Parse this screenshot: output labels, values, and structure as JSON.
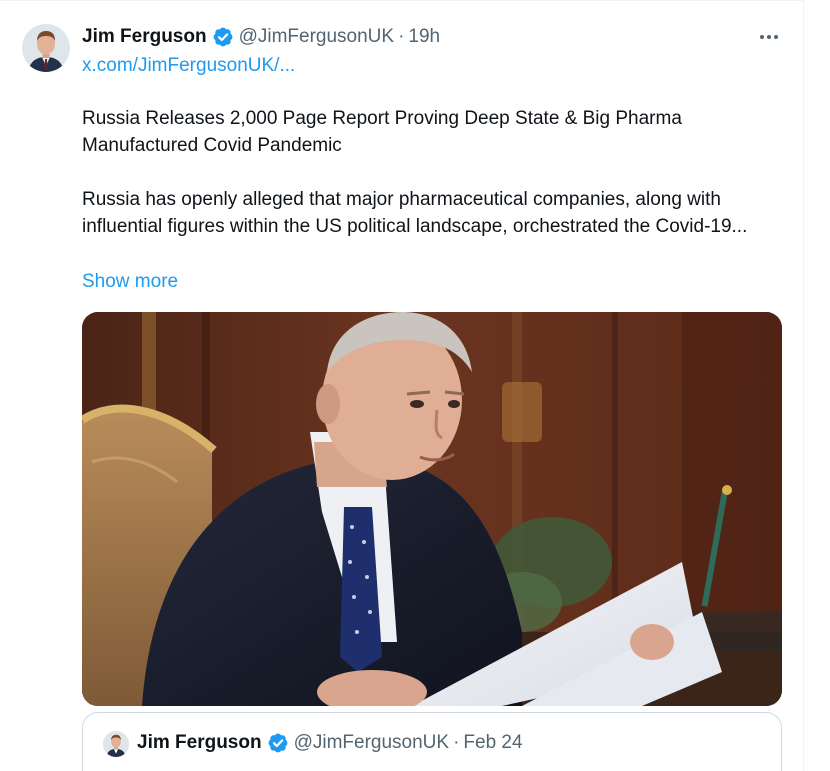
{
  "tweet": {
    "author": {
      "display_name": "Jim Ferguson",
      "handle": "@JimFergusonUK",
      "verified": true,
      "avatar_icon": "profile-photo-avatar"
    },
    "separator": "·",
    "timestamp": "19h",
    "profile_link": "x.com/JimFergusonUK/...",
    "paragraphs": [
      "Russia Releases 2,000 Page Report Proving Deep State & Big Pharma Manufactured Covid Pandemic",
      "Russia has openly alleged that major pharmaceutical companies, along with influential figures within the US political landscape, orchestrated the Covid-19..."
    ],
    "show_more_label": "Show more",
    "more_icon": "more-horizontal-icon"
  },
  "quoted_tweet": {
    "author": {
      "display_name": "Jim Ferguson",
      "handle": "@JimFergusonUK",
      "verified": true
    },
    "separator": "·",
    "timestamp": "Feb 24"
  },
  "colors": {
    "text_primary": "#0f1419",
    "text_secondary": "#536471",
    "link_blue": "#1d9bf0",
    "verified_blue": "#1d9bf0",
    "border": "#cfd9de"
  }
}
